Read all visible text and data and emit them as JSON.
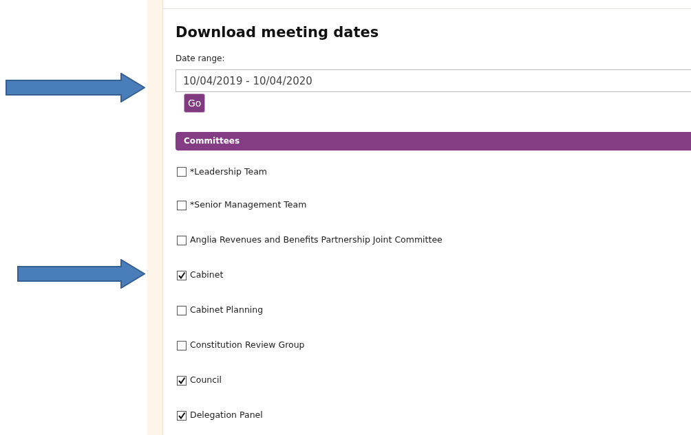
{
  "title": "Download meeting dates",
  "date_range": {
    "label": "Date range:",
    "value": "10/04/2019 - 10/04/2020"
  },
  "go_button": "Go",
  "committees": {
    "heading": "Committees",
    "items": [
      {
        "label": "*Leadership Team",
        "checked": false
      },
      {
        "label": "*Senior Management Team",
        "checked": false
      },
      {
        "label": "Anglia Revenues and Benefits Partnership Joint Committee",
        "checked": false
      },
      {
        "label": "Cabinet",
        "checked": true
      },
      {
        "label": "Cabinet Planning",
        "checked": false
      },
      {
        "label": "Constitution Review Group",
        "checked": false
      },
      {
        "label": "Council",
        "checked": true
      },
      {
        "label": "Delegation Panel",
        "checked": true
      }
    ]
  }
}
